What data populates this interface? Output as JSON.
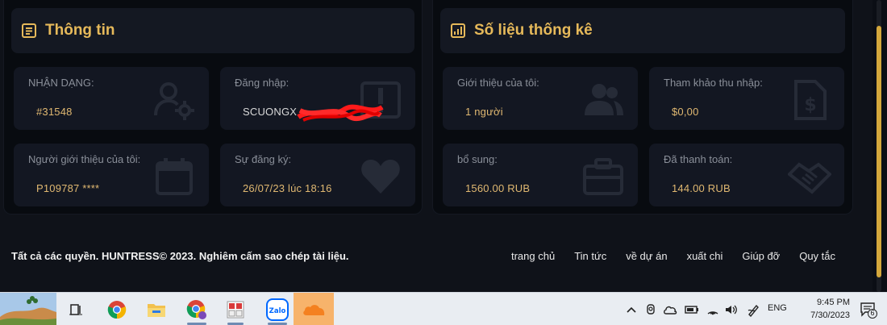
{
  "info_panel": {
    "title": "Thông tin",
    "cards": [
      {
        "label": "NHẬN DẠNG:",
        "value": "#31548",
        "icon": "user-gear-icon"
      },
      {
        "label": "Đăng nhập:",
        "value": "SCUONGX",
        "icon": "id-badge-icon"
      },
      {
        "label": "Người giới thiệu của tôi:",
        "value": "P109787 ****",
        "icon": "calendar-icon"
      },
      {
        "label": "Sự đăng ký:",
        "value": "26/07/23 lúc 18:16",
        "icon": "heart-icon"
      }
    ]
  },
  "stats_panel": {
    "title": "Số liệu thống kê",
    "cards": [
      {
        "label": "Giới thiệu của tôi:",
        "value": "1 người",
        "icon": "users-icon"
      },
      {
        "label": "Tham khảo thu nhập:",
        "value": "$0,00",
        "icon": "dollar-document-icon"
      },
      {
        "label": "bổ sung:",
        "value": "1560.00 RUB",
        "icon": "briefcase-icon"
      },
      {
        "label": "Đã thanh toán:",
        "value": "144.00 RUB",
        "icon": "handshake-icon"
      }
    ]
  },
  "footer": {
    "copyright": "Tất cả các quyền. HUNTRESS© 2023. Nghiêm cấm sao chép tài liệu.",
    "links": [
      "trang chủ",
      "Tin tức",
      "về dự án",
      "xuất chi",
      "Giúp đỡ",
      "Quy tắc"
    ]
  },
  "taskbar": {
    "time": "9:45 PM",
    "date": "7/30/2023",
    "language": "ENG",
    "notification_count": "6"
  },
  "colors": {
    "accent": "#e0b871",
    "panel_bg": "#080b10",
    "card_bg": "#131722",
    "taskbar_bg": "#e9edf2"
  }
}
